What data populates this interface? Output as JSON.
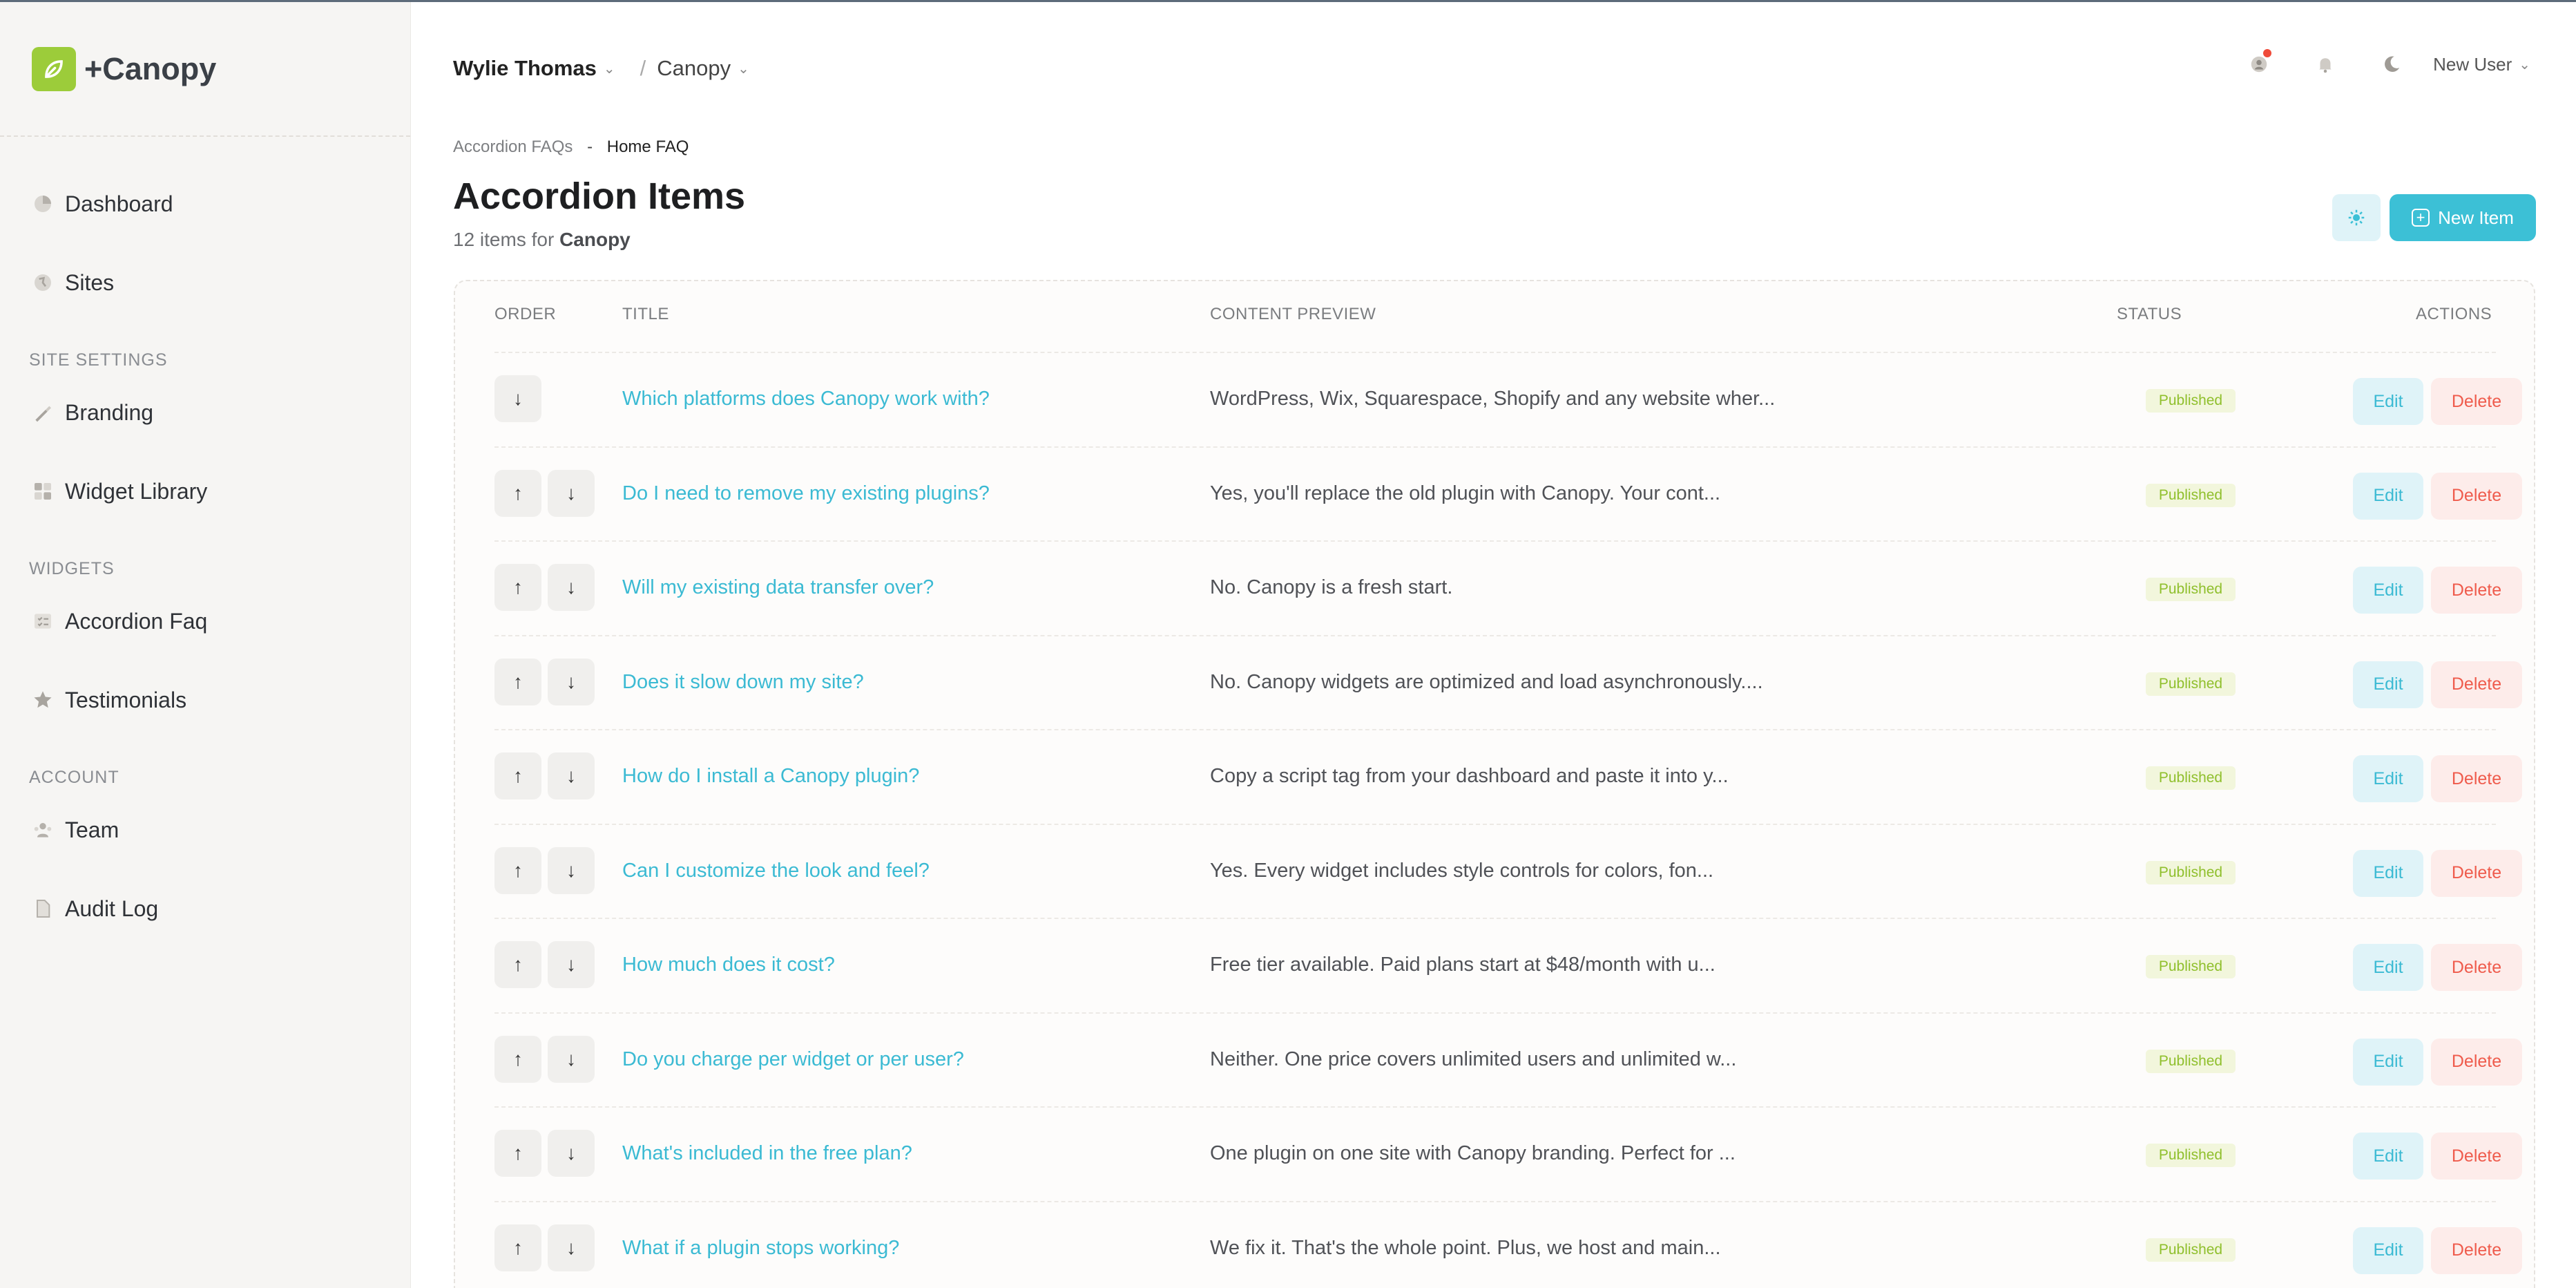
{
  "brand": {
    "name": "+Canopy"
  },
  "sidebar": {
    "items": [
      {
        "label": "Dashboard",
        "icon": "pie-chart-icon"
      },
      {
        "label": "Sites",
        "icon": "globe-icon"
      }
    ],
    "sections": [
      {
        "title": "SITE SETTINGS",
        "items": [
          {
            "label": "Branding",
            "icon": "brush-icon"
          },
          {
            "label": "Widget Library",
            "icon": "grid-icon"
          }
        ]
      },
      {
        "title": "WIDGETS",
        "items": [
          {
            "label": "Accordion Faq",
            "icon": "list-icon"
          },
          {
            "label": "Testimonials",
            "icon": "star-icon"
          }
        ]
      },
      {
        "title": "ACCOUNT",
        "items": [
          {
            "label": "Team",
            "icon": "team-icon"
          },
          {
            "label": "Audit Log",
            "icon": "document-icon"
          }
        ]
      }
    ]
  },
  "topbar": {
    "org": "Wylie Thomas",
    "site": "Canopy",
    "user": "New User"
  },
  "breadcrumb": {
    "parent": "Accordion FAQs",
    "current": "Home FAQ"
  },
  "page": {
    "title": "Accordion Items",
    "subtitle_prefix": "12 items for",
    "subtitle_site": "Canopy",
    "new_button": "New Item"
  },
  "table": {
    "headers": {
      "order": "ORDER",
      "title": "TITLE",
      "preview": "CONTENT PREVIEW",
      "status": "STATUS",
      "actions": "ACTIONS"
    },
    "edit_label": "Edit",
    "delete_label": "Delete",
    "rows": [
      {
        "title": "Which platforms does Canopy work with?",
        "preview": "WordPress, Wix, Squarespace, Shopify and any website wher...",
        "status": "Published"
      },
      {
        "title": "Do I need to remove my existing plugins?",
        "preview": "Yes, you'll replace the old plugin with Canopy. Your cont...",
        "status": "Published"
      },
      {
        "title": "Will my existing data transfer over?",
        "preview": "No. Canopy is a fresh start.",
        "status": "Published"
      },
      {
        "title": "Does it slow down my site?",
        "preview": "No. Canopy widgets are optimized and load asynchronously....",
        "status": "Published"
      },
      {
        "title": "How do I install a Canopy plugin?",
        "preview": "Copy a script tag from your dashboard and paste it into y...",
        "status": "Published"
      },
      {
        "title": "Can I customize the look and feel?",
        "preview": "Yes. Every widget includes style controls for colors, fon...",
        "status": "Published"
      },
      {
        "title": "How much does it cost?",
        "preview": "Free tier available. Paid plans start at $48/month with u...",
        "status": "Published"
      },
      {
        "title": "Do you charge per widget or per user?",
        "preview": "Neither. One price covers unlimited users and unlimited w...",
        "status": "Published"
      },
      {
        "title": "What's included in the free plan?",
        "preview": "One plugin on one site with Canopy branding. Perfect for ...",
        "status": "Published"
      },
      {
        "title": "What if a plugin stops working?",
        "preview": "We fix it. That's the whole point. Plus, we host and main...",
        "status": "Published"
      }
    ]
  },
  "colors": {
    "accent": "#3cc0d6",
    "brand": "#9ccc3a",
    "danger": "#ef5b4c",
    "status_published": "#8fbf2c"
  }
}
